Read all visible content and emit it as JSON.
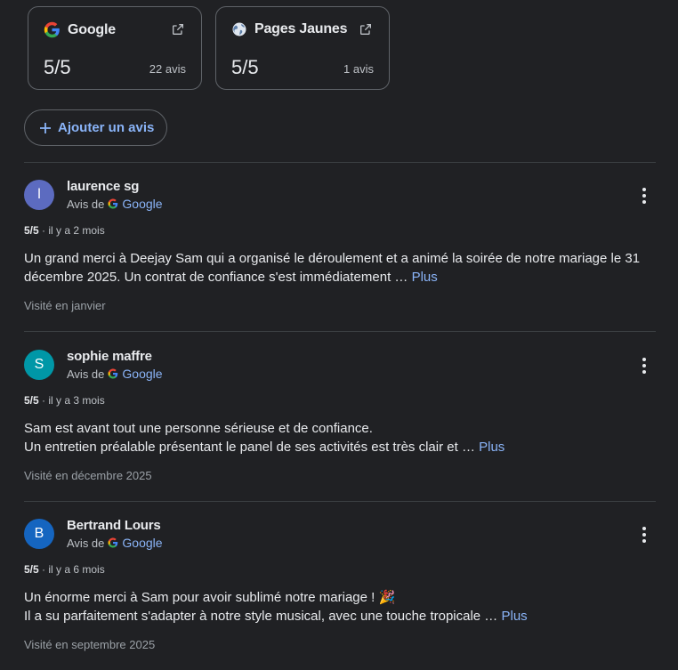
{
  "sources": [
    {
      "name": "Google",
      "score": "5/5",
      "count": "22 avis"
    },
    {
      "name": "Pages Jaunes",
      "score": "5/5",
      "count": "1 avis"
    }
  ],
  "add_review_label": "Ajouter un avis",
  "via_label": "Avis de",
  "via_source": "Google",
  "more_label": "Plus",
  "reviews": [
    {
      "initial": "l",
      "avatar_color": "#5c6bc0",
      "name": "laurence sg",
      "rating": "5/5",
      "time": "· il y a 2 mois",
      "line1": "Un grand merci à Deejay Sam qui a organisé le déroulement et a animé la soirée de notre mariage le 31",
      "line2": "décembre 2025. Un contrat de confiance s'est immédiatement …",
      "visited": "Visité en janvier"
    },
    {
      "initial": "S",
      "avatar_color": "#0097a7",
      "name": "sophie maffre",
      "rating": "5/5",
      "time": "· il y a 3 mois",
      "line1": "Sam est avant tout une personne sérieuse et de confiance.",
      "line2": "Un entretien préalable présentant le panel de ses activités est très clair et …",
      "visited": "Visité en décembre 2025"
    },
    {
      "initial": "B",
      "avatar_color": "#1565c0",
      "name": "Bertrand Lours",
      "rating": "5/5",
      "time": "· il y a 6 mois",
      "line1": "Un énorme merci à Sam pour avoir sublimé notre mariage ! 🎉",
      "line2": "Il a su parfaitement s'adapter à notre style musical, avec une touche tropicale …",
      "visited": "Visité en septembre 2025"
    }
  ]
}
